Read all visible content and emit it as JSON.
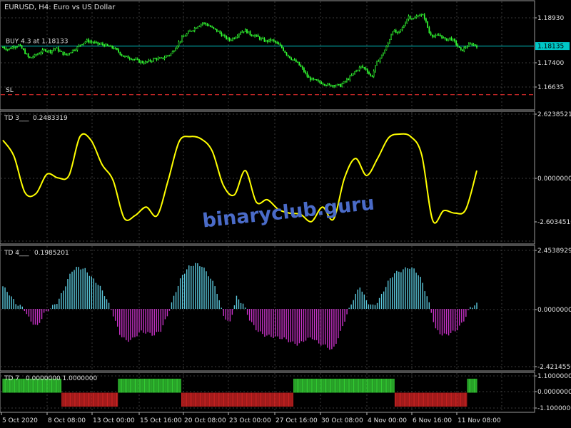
{
  "chart_data": [
    {
      "type": "candlestick",
      "title": "EURUSD, H4:  Euro vs US Dollar",
      "y_ticks": [
        "1.18930",
        "1.17400",
        "1.16635"
      ],
      "ylim": [
        1.1625,
        1.1938
      ],
      "current_price": "1.18135",
      "order_label": "BUY 4.3 at 1.18133",
      "order_price": 1.18133,
      "sl_label": "SL",
      "sl_price": 1.1663,
      "close_series": [
        1.181,
        1.1803,
        1.1812,
        1.1816,
        1.1798,
        1.1775,
        1.1783,
        1.1793,
        1.1802,
        1.1797,
        1.1808,
        1.1794,
        1.1785,
        1.1798,
        1.1807,
        1.1822,
        1.183,
        1.1825,
        1.182,
        1.1818,
        1.1812,
        1.1808,
        1.1795,
        1.178,
        1.1778,
        1.1772,
        1.1765,
        1.1762,
        1.1768,
        1.1775,
        1.1773,
        1.1782,
        1.179,
        1.1815,
        1.1838,
        1.1852,
        1.1864,
        1.1876,
        1.1885,
        1.1878,
        1.1866,
        1.1857,
        1.1842,
        1.1832,
        1.184,
        1.1856,
        1.1862,
        1.185,
        1.1845,
        1.1835,
        1.1828,
        1.1832,
        1.1822,
        1.1808,
        1.1786,
        1.1772,
        1.176,
        1.174,
        1.1715,
        1.1708,
        1.1702,
        1.1698,
        1.1691,
        1.1694,
        1.169,
        1.1704,
        1.1718,
        1.1736,
        1.175,
        1.1742,
        1.1716,
        1.1762,
        1.1785,
        1.1815,
        1.1862,
        1.1851,
        1.1872,
        1.1906,
        1.1896,
        1.1912,
        1.1905,
        1.1854,
        1.1842,
        1.1848,
        1.1832,
        1.1838,
        1.1822,
        1.1798,
        1.1812,
        1.182,
        1.1814
      ]
    },
    {
      "type": "line",
      "name_label": "TD 3___",
      "value_label": "0.2483319",
      "y_ticks": [
        "2.6238521",
        "0.0000000",
        "-2.6034510"
      ],
      "ylim": [
        -2.603451,
        2.6238521
      ],
      "color": "#ffff00",
      "values": [
        1.55,
        0.9,
        -0.6,
        -0.65,
        0.15,
        0.0,
        0.1,
        1.7,
        1.55,
        0.55,
        -0.1,
        -1.65,
        -1.55,
        -1.2,
        -1.55,
        -0.1,
        1.5,
        1.7,
        1.6,
        1.1,
        -0.3,
        -0.7,
        0.3,
        -1.0,
        -0.9,
        -1.3,
        -1.45,
        -1.5,
        -1.8,
        -1.2,
        -1.7,
        0.0,
        0.8,
        0.1,
        0.8,
        1.65,
        1.8,
        1.7,
        0.95,
        -1.75,
        -1.35,
        -1.45,
        -1.3,
        0.3
      ]
    },
    {
      "type": "bar",
      "name_label": "TD 4___",
      "value_label": "0.1985201",
      "y_ticks": [
        "2.4538929",
        "0.0000000",
        "-2.4214550"
      ],
      "ylim": [
        -2.421455,
        2.4538929
      ],
      "colors": {
        "positive": "#5bc8dc",
        "negative": "#c832c8"
      },
      "values": [
        0.95,
        0.6,
        0.2,
        0.05,
        -0.5,
        -0.75,
        -0.2,
        0.05,
        0.3,
        0.9,
        1.6,
        1.75,
        1.65,
        1.3,
        1.0,
        0.5,
        -0.2,
        -1.05,
        -1.35,
        -1.25,
        -0.95,
        -1.0,
        -1.1,
        -0.9,
        -0.25,
        0.6,
        1.35,
        1.75,
        1.9,
        1.8,
        1.4,
        0.9,
        -0.2,
        -0.65,
        0.5,
        0.2,
        -0.5,
        -0.9,
        -1.1,
        -1.15,
        -1.2,
        -1.25,
        -1.4,
        -1.5,
        -1.3,
        -1.2,
        -1.45,
        -1.55,
        -1.75,
        -1.1,
        -0.3,
        0.4,
        0.95,
        0.3,
        0.1,
        0.5,
        1.1,
        1.5,
        1.6,
        1.75,
        1.65,
        1.2,
        0.3,
        -0.85,
        -1.1,
        -1.05,
        -0.9,
        -0.55,
        0.05,
        0.2
      ]
    },
    {
      "type": "bar",
      "name_label": "TD 7",
      "value_label": "0.0000000  1.0000000",
      "y_ticks": [
        "1.1000000",
        "0.0000000",
        "-1.1000000"
      ],
      "ylim": [
        -1.3,
        1.35
      ],
      "colors": {
        "positive": "#33cc33",
        "negative": "#cc2222"
      },
      "values": [
        1,
        1,
        1,
        1,
        1,
        1,
        1,
        1,
        1,
        1,
        1,
        1,
        1,
        1,
        1,
        1,
        1,
        1,
        1,
        1,
        1,
        1,
        1,
        1,
        1,
        1,
        1,
        1,
        1,
        1,
        1,
        1,
        1,
        1,
        1,
        1,
        1,
        1,
        1,
        1,
        1,
        1,
        1,
        1,
        1,
        1,
        1,
        1,
        1,
        1,
        1,
        1,
        1,
        1,
        1,
        1,
        1,
        1,
        1,
        1,
        1,
        1,
        1,
        1,
        1,
        1,
        1,
        1,
        1,
        1,
        -1,
        -1,
        -1,
        -1,
        -1,
        -1,
        -1,
        -1,
        -1,
        -1,
        -1,
        -1,
        -1,
        -1,
        -1,
        -1,
        -1,
        -1,
        -1,
        -1,
        -1,
        -1,
        -1,
        -1,
        -1,
        -1,
        -1,
        -1,
        -1,
        -1,
        -1,
        -1,
        -1,
        -1,
        -1,
        -1,
        -1,
        -1,
        -1,
        -1,
        -1,
        -1,
        -1,
        -1,
        -1,
        -1,
        -1,
        -1,
        -1,
        -1,
        -1,
        -1,
        -1,
        -1,
        -1,
        -1,
        -1,
        -1,
        -1,
        -1,
        -1,
        -1,
        -1,
        -1,
        -1,
        -1,
        -1,
        1,
        1,
        1,
        1,
        1,
        1,
        1,
        1,
        1,
        1,
        1,
        1,
        1,
        1,
        1,
        1,
        1,
        1,
        1,
        1,
        1,
        1,
        1,
        1,
        1,
        1,
        1,
        1,
        1,
        1,
        1,
        1,
        1,
        1,
        1,
        1,
        1,
        1,
        1,
        1,
        1,
        1,
        1,
        1,
        1,
        1,
        1,
        1,
        1,
        1,
        1,
        1,
        1,
        1,
        1,
        1,
        1,
        1,
        1,
        1,
        1,
        1,
        1,
        1,
        1,
        1,
        1,
        1,
        1,
        1,
        1,
        1,
        1,
        1,
        1,
        -1,
        -1,
        -1,
        -1,
        -1,
        -1,
        -1,
        -1,
        -1,
        -1,
        -1,
        -1,
        -1,
        -1,
        -1,
        -1,
        -1,
        -1,
        -1,
        -1,
        -1,
        -1,
        -1,
        -1,
        -1,
        -1,
        -1,
        -1,
        -1,
        -1,
        -1,
        -1,
        -1,
        -1,
        -1,
        -1,
        -1,
        -1,
        -1,
        -1,
        -1,
        -1,
        -1,
        -1,
        -1,
        -1,
        -1,
        -1,
        -1,
        -1,
        -1,
        -1,
        -1,
        -1,
        -1,
        -1,
        -1,
        -1,
        -1,
        -1,
        -1,
        -1,
        -1,
        -1,
        -1,
        -1,
        -1,
        -1,
        -1,
        -1,
        -1,
        -1,
        -1,
        -1,
        -1,
        -1,
        -1,
        -1,
        -1,
        -1,
        -1,
        -1,
        -1,
        -1,
        -1,
        -1,
        -1,
        -1,
        -1,
        -1,
        -1,
        -1,
        -1,
        -1,
        -1,
        -1,
        -1,
        -1,
        -1,
        -1,
        -1,
        -1,
        -1,
        -1,
        -1,
        -1,
        -1,
        -1,
        -1,
        -1,
        -1,
        -1,
        -1,
        -1,
        -1,
        -1,
        -1,
        -1,
        -1,
        -1,
        -1,
        -1,
        -1,
        -1,
        -1,
        -1,
        -1,
        -1,
        -1,
        -1,
        -1,
        -1,
        -1,
        1,
        1,
        1,
        1,
        1,
        1,
        1,
        1,
        1,
        1,
        1,
        1,
        1,
        1,
        1,
        1,
        1,
        1,
        1,
        1,
        1,
        1,
        1,
        1,
        1,
        1,
        1,
        1,
        1,
        1,
        1,
        1,
        1,
        1,
        1,
        1,
        1,
        1,
        1,
        1,
        1,
        1,
        1,
        1,
        1,
        1,
        1,
        1,
        1,
        1,
        1,
        1,
        1,
        1,
        1,
        1,
        1,
        1,
        1,
        1,
        1,
        1,
        1,
        1,
        1,
        1,
        1,
        1,
        1,
        1,
        1,
        1,
        1,
        1,
        1,
        1,
        1,
        1,
        1,
        1,
        1,
        1,
        1,
        1,
        1,
        1,
        1,
        1,
        1,
        1,
        1,
        1,
        1,
        1,
        1,
        1,
        1,
        1,
        1,
        1,
        1,
        1,
        1,
        1,
        1,
        1,
        1,
        1,
        1,
        1,
        1,
        1,
        1,
        1,
        1,
        1,
        1,
        1,
        1,
        1,
        -1,
        -1,
        -1,
        -1,
        -1,
        -1,
        -1,
        -1,
        -1,
        -1,
        -1,
        -1,
        -1,
        -1,
        -1,
        -1,
        -1,
        -1,
        -1,
        -1,
        -1,
        -1,
        -1,
        -1,
        -1,
        -1,
        -1,
        -1,
        -1,
        -1,
        -1,
        -1,
        -1,
        -1,
        -1,
        -1,
        -1,
        -1,
        -1,
        -1,
        -1,
        -1,
        -1,
        -1,
        -1,
        -1,
        -1,
        -1,
        -1,
        -1,
        -1,
        -1,
        -1,
        -1,
        -1,
        -1,
        -1,
        -1,
        -1,
        -1,
        -1,
        -1,
        -1,
        -1,
        -1,
        -1,
        -1,
        -1,
        -1,
        -1,
        -1,
        -1,
        -1,
        -1,
        -1,
        -1,
        -1,
        -1,
        -1,
        -1,
        -1,
        -1,
        -1,
        -1,
        -1,
        -1,
        1,
        1,
        1,
        1,
        1,
        1,
        1,
        1,
        1,
        1,
        1,
        1
      ]
    }
  ],
  "x_ticks": [
    "5 Oct 2020",
    "8 Oct 08:00",
    "13 Oct 00:00",
    "15 Oct 16:00",
    "20 Oct 08:00",
    "23 Oct 00:00",
    "27 Oct 16:00",
    "30 Oct 08:00",
    "4 Nov 00:00",
    "6 Nov 16:00",
    "11 Nov 08:00"
  ],
  "watermark": "binaryclub.guru",
  "colors": {
    "candles": "#33ff33",
    "bid_line": "#00c8c8",
    "price_tag_bg": "#00c8c8",
    "sl_line": "#ff3333",
    "grid": "#3a3a3a",
    "watermark": "#4a6bc8"
  }
}
